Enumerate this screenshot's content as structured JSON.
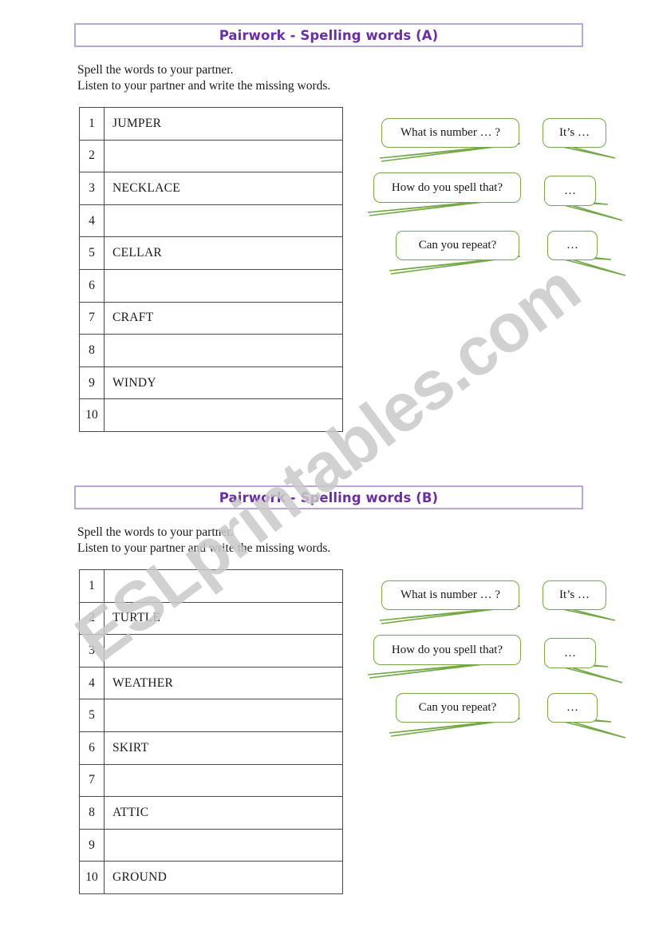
{
  "watermark": {
    "text": "ESLprintables.com"
  },
  "sections": [
    {
      "id": "a",
      "title": "Pairwork - Spelling words (A)",
      "instructions": [
        "Spell the words to your partner.",
        "Listen to your partner and write the missing words."
      ],
      "table": {
        "rows": [
          {
            "number": "1",
            "word": "JUMPER"
          },
          {
            "number": "2",
            "word": ""
          },
          {
            "number": "3",
            "word": "NECKLACE"
          },
          {
            "number": "4",
            "word": ""
          },
          {
            "number": "5",
            "word": "CELLAR"
          },
          {
            "number": "6",
            "word": ""
          },
          {
            "number": "7",
            "word": "CRAFT"
          },
          {
            "number": "8",
            "word": ""
          },
          {
            "number": "9",
            "word": "WINDY"
          },
          {
            "number": "10",
            "word": ""
          }
        ]
      },
      "bubbles": {
        "left": [
          "What is number … ?",
          "How do you spell that?",
          "Can you repeat?"
        ],
        "right": [
          "It’s …",
          "…",
          "…"
        ]
      }
    },
    {
      "id": "b",
      "title": "Pairwork - Spelling words (B)",
      "instructions": [
        "Spell the words to your partner.",
        "Listen to your partner and write the missing words."
      ],
      "table": {
        "rows": [
          {
            "number": "1",
            "word": ""
          },
          {
            "number": "2",
            "word": "TURTLE"
          },
          {
            "number": "3",
            "word": ""
          },
          {
            "number": "4",
            "word": "WEATHER"
          },
          {
            "number": "5",
            "word": ""
          },
          {
            "number": "6",
            "word": "SKIRT"
          },
          {
            "number": "7",
            "word": ""
          },
          {
            "number": "8",
            "word": "ATTIC"
          },
          {
            "number": "9",
            "word": ""
          },
          {
            "number": "10",
            "word": "GROUND"
          }
        ]
      },
      "bubbles": {
        "left": [
          "What is number … ?",
          "How do you spell that?",
          "Can you repeat?"
        ],
        "right": [
          "It’s …",
          "…",
          "…"
        ]
      }
    }
  ],
  "colors": {
    "title_text": "#6a2fa0",
    "title_border": "#b9a7cf",
    "bubble_border": "#76a84a",
    "table_border": "#4a4a4a",
    "watermark": "#c9c9c9"
  }
}
